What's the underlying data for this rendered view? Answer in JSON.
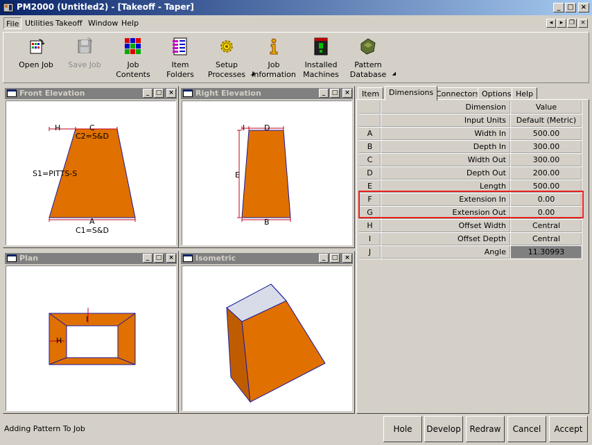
{
  "window": {
    "title": "PM2000 (Untitled2) - [Takeoff - Taper]"
  },
  "menu": [
    "File",
    "Utilities",
    "Takeoff",
    "Window",
    "Help"
  ],
  "toolbar": {
    "open_job": [
      "Open Job"
    ],
    "save_job": [
      "Save Job"
    ],
    "job_contents": [
      "Job",
      "Contents"
    ],
    "item_folders": [
      "Item",
      "Folders"
    ],
    "setup_processes": [
      "Setup",
      "Processes"
    ],
    "job_information": [
      "Job",
      "Information"
    ],
    "installed_machines": [
      "Installed",
      "Machines"
    ],
    "pattern_database": [
      "Pattern",
      "Database"
    ]
  },
  "views": {
    "front": {
      "title": "Front Elevation",
      "labels": {
        "H": "H",
        "C": "C",
        "C2": "C2=S&D",
        "S1": "S1=PITTS-S",
        "A": "A",
        "C1": "C1=S&D"
      }
    },
    "right": {
      "title": "Right Elevation",
      "labels": {
        "I": "I",
        "D": "D",
        "E": "E",
        "B": "B"
      }
    },
    "plan": {
      "title": "Plan",
      "labels": {
        "I": "I",
        "H": "H"
      }
    },
    "iso": {
      "title": "Isometric"
    }
  },
  "tabs": [
    "Item",
    "Dimensions",
    "Connectors",
    "Options",
    "Help"
  ],
  "active_tab": "Dimensions",
  "grid": {
    "header": {
      "dimension": "Dimension",
      "value": "Value"
    },
    "units": {
      "label": "Input Units",
      "value": "Default (Metric)"
    },
    "rows": [
      {
        "label": "A",
        "name": "Width In",
        "value": "500.00"
      },
      {
        "label": "B",
        "name": "Depth In",
        "value": "300.00"
      },
      {
        "label": "C",
        "name": "Width Out",
        "value": "300.00"
      },
      {
        "label": "D",
        "name": "Depth Out",
        "value": "200.00"
      },
      {
        "label": "E",
        "name": "Length",
        "value": "500.00"
      },
      {
        "label": "F",
        "name": "Extension In",
        "value": "0.00"
      },
      {
        "label": "G",
        "name": "Extension Out",
        "value": "0.00"
      },
      {
        "label": "H",
        "name": "Offset Width",
        "value": "Central"
      },
      {
        "label": "I",
        "name": "Offset Depth",
        "value": "Central"
      },
      {
        "label": "J",
        "name": "Angle",
        "value": "11.30993"
      }
    ]
  },
  "status_text": "Adding Pattern To Job",
  "buttons": {
    "hole": "Hole",
    "develop": "Develop",
    "redraw": "Redraw",
    "cancel": "Cancel",
    "accept": "Accept"
  },
  "colors": {
    "material": "#e07000",
    "outline": "#1a1aa0",
    "highlight": "#e8211c",
    "titlebar": "#0a246a"
  }
}
